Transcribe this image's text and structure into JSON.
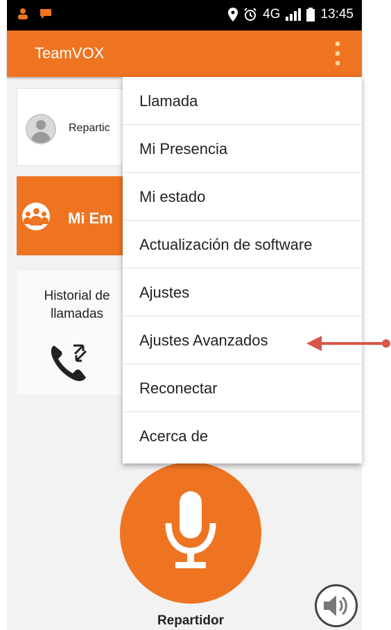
{
  "status_bar": {
    "network": "4G",
    "time": "13:45",
    "icons": [
      "person-notification-icon",
      "chat-notification-icon",
      "location-icon",
      "alarm-icon",
      "signal-icon",
      "battery-icon"
    ]
  },
  "app_bar": {
    "title": "TeamVOX",
    "overflow_icon": "more-vertical-icon"
  },
  "cards": {
    "contact_label": "Repartic",
    "team_label": "Mi Em",
    "history_label": "Historial de llamadas"
  },
  "overflow_menu": {
    "items": [
      {
        "label": "Llamada"
      },
      {
        "label": "Mi Presencia"
      },
      {
        "label": "Mi estado"
      },
      {
        "label": "Actualización de software"
      },
      {
        "label": "Ajustes"
      },
      {
        "label": "Ajustes Avanzados",
        "highlighted": true
      },
      {
        "label": "Reconectar"
      },
      {
        "label": "Acerca de"
      }
    ]
  },
  "ptt": {
    "icon": "microphone-icon",
    "label": "Repartidor"
  },
  "speaker_icon": "speaker-icon",
  "colors": {
    "accent": "#ef7422",
    "annotation_arrow": "#d9574a",
    "status_bar": "#000000"
  }
}
